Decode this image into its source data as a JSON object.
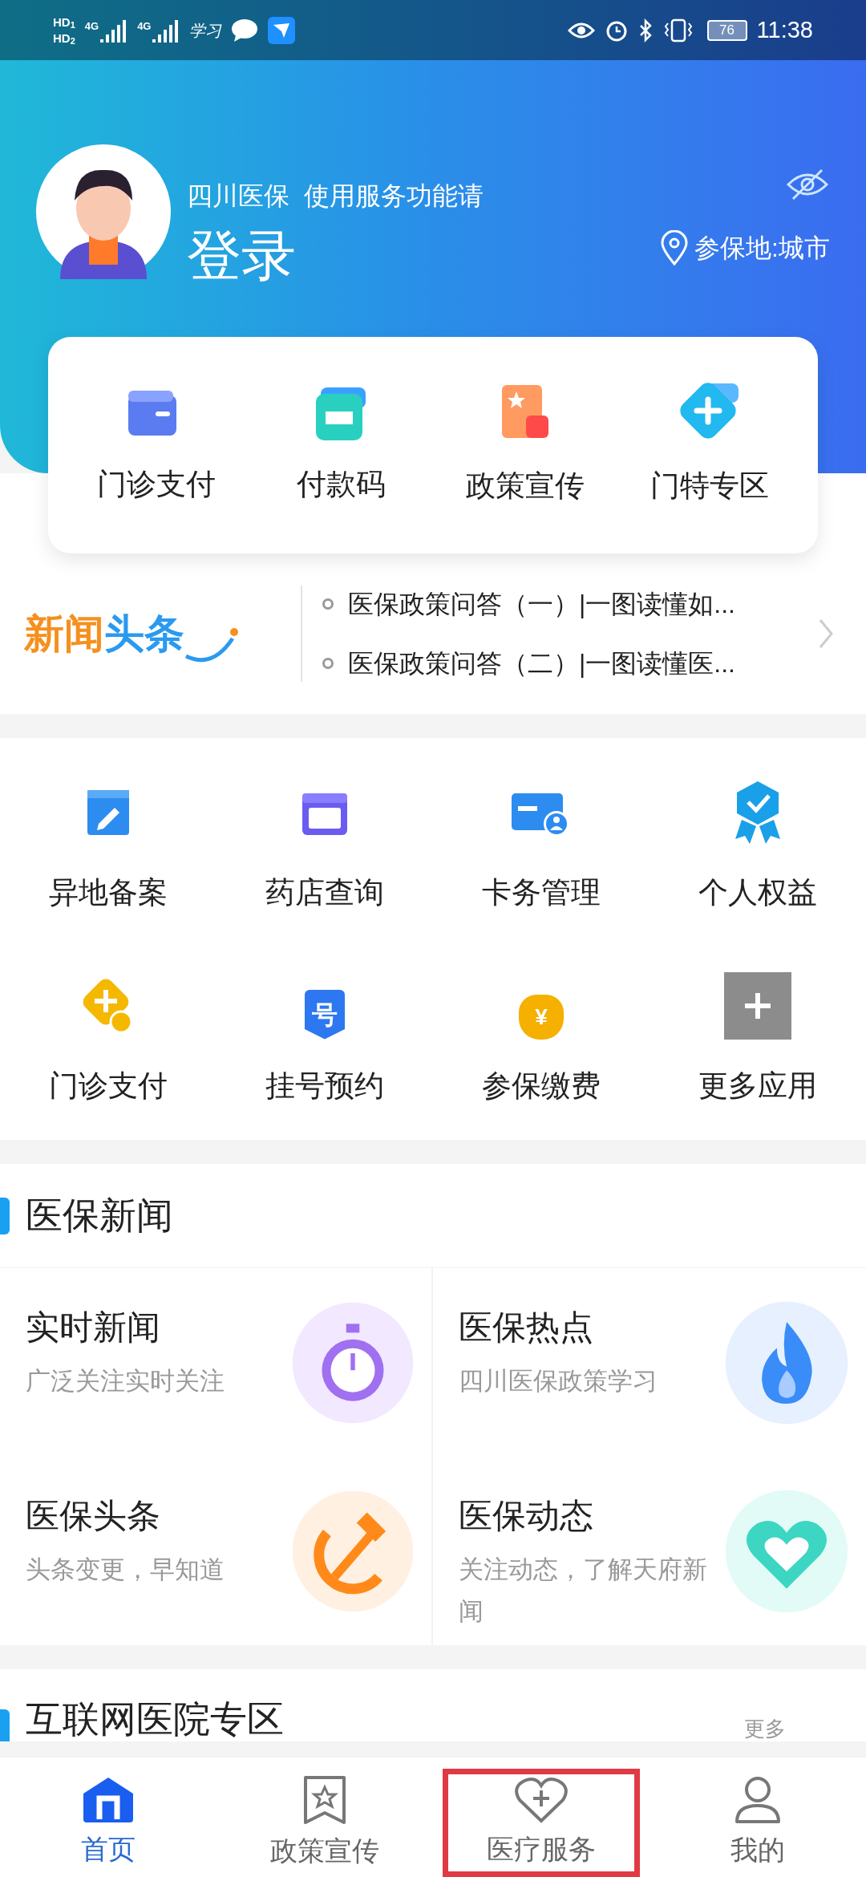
{
  "status_bar": {
    "sims": [
      {
        "label": "HD",
        "slot": "1"
      },
      {
        "label": "HD",
        "slot": "2"
      }
    ],
    "networks": [
      "4G",
      "4G"
    ],
    "app_label": "学习",
    "battery": "76",
    "time": "11:38"
  },
  "profile": {
    "greeting": "四川医保  使用服务功能请",
    "login": "登录",
    "location": "参保地:城市"
  },
  "quick_actions": [
    {
      "label": "门诊支付"
    },
    {
      "label": "付款码"
    },
    {
      "label": "政策宣传"
    },
    {
      "label": "门特专区"
    }
  ],
  "news_ticker": {
    "logo_parts": [
      "新闻",
      "头条"
    ],
    "items": [
      "医保政策问答（一）|一图读懂如...",
      "医保政策问答（二）|一图读懂医..."
    ]
  },
  "services": [
    {
      "label": "异地备案"
    },
    {
      "label": "药店查询"
    },
    {
      "label": "卡务管理"
    },
    {
      "label": "个人权益"
    },
    {
      "label": "门诊支付"
    },
    {
      "label": "挂号预约",
      "icon_text": "号"
    },
    {
      "label": "参保缴费",
      "icon_text": "¥"
    },
    {
      "label": "更多应用"
    }
  ],
  "news_section": {
    "title": "医保新闻",
    "cards": [
      {
        "title": "实时新闻",
        "subtitle": "广泛关注实时关注"
      },
      {
        "title": "医保热点",
        "subtitle": "四川医保政策学习"
      },
      {
        "title": "医保头条",
        "subtitle": "头条变更，早知道"
      },
      {
        "title": "医保动态",
        "subtitle": "关注动态，了解天府新闻"
      }
    ]
  },
  "next_section": {
    "title": "互联网医院专区",
    "more": "更多"
  },
  "bottom_nav": [
    {
      "label": "首页",
      "selected": true,
      "highlighted": false
    },
    {
      "label": "政策宣传",
      "selected": false,
      "highlighted": false
    },
    {
      "label": "医疗服务",
      "selected": false,
      "highlighted": true
    },
    {
      "label": "我的",
      "selected": false,
      "highlighted": false
    }
  ]
}
